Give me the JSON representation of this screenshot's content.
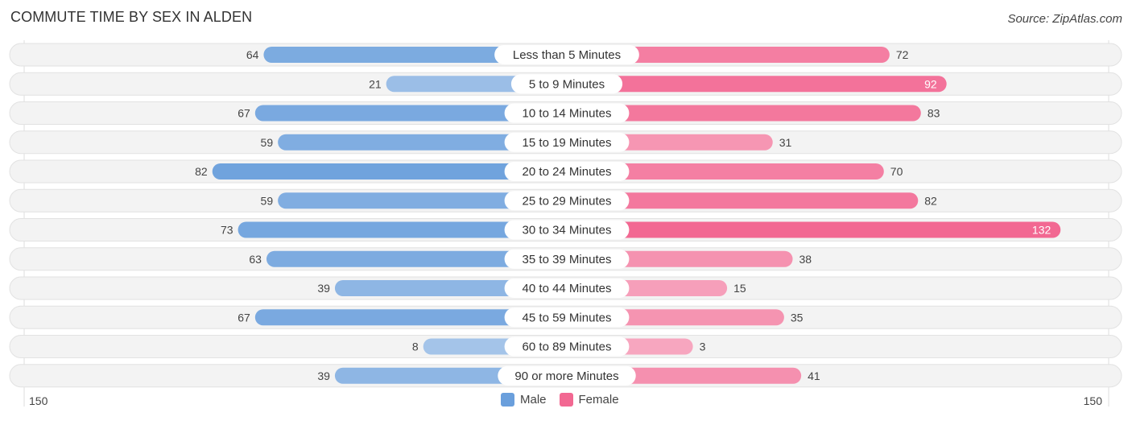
{
  "header": {
    "title": "COMMUTE TIME BY SEX IN ALDEN",
    "source": "Source: ZipAtlas.com"
  },
  "colors": {
    "male": "#6a9fdc",
    "male_light": "#aac8ea",
    "female": "#f26892",
    "female_light": "#f7a8c0",
    "track": "#f3f3f3"
  },
  "chart_data": {
    "type": "bar",
    "orientation": "horizontal-diverging",
    "title": "COMMUTE TIME BY SEX IN ALDEN",
    "categories": [
      "Less than 5 Minutes",
      "5 to 9 Minutes",
      "10 to 14 Minutes",
      "15 to 19 Minutes",
      "20 to 24 Minutes",
      "25 to 29 Minutes",
      "30 to 34 Minutes",
      "35 to 39 Minutes",
      "40 to 44 Minutes",
      "45 to 59 Minutes",
      "60 to 89 Minutes",
      "90 or more Minutes"
    ],
    "series": [
      {
        "name": "Male",
        "side": "left",
        "values": [
          64,
          21,
          67,
          59,
          82,
          59,
          73,
          63,
          39,
          67,
          8,
          39
        ]
      },
      {
        "name": "Female",
        "side": "right",
        "values": [
          72,
          92,
          83,
          31,
          70,
          82,
          132,
          38,
          15,
          35,
          3,
          41
        ]
      }
    ],
    "axis": {
      "left_label": "150",
      "right_label": "150",
      "max": 150
    },
    "legend": {
      "position": "bottom-center",
      "entries": [
        "Male",
        "Female"
      ]
    }
  }
}
